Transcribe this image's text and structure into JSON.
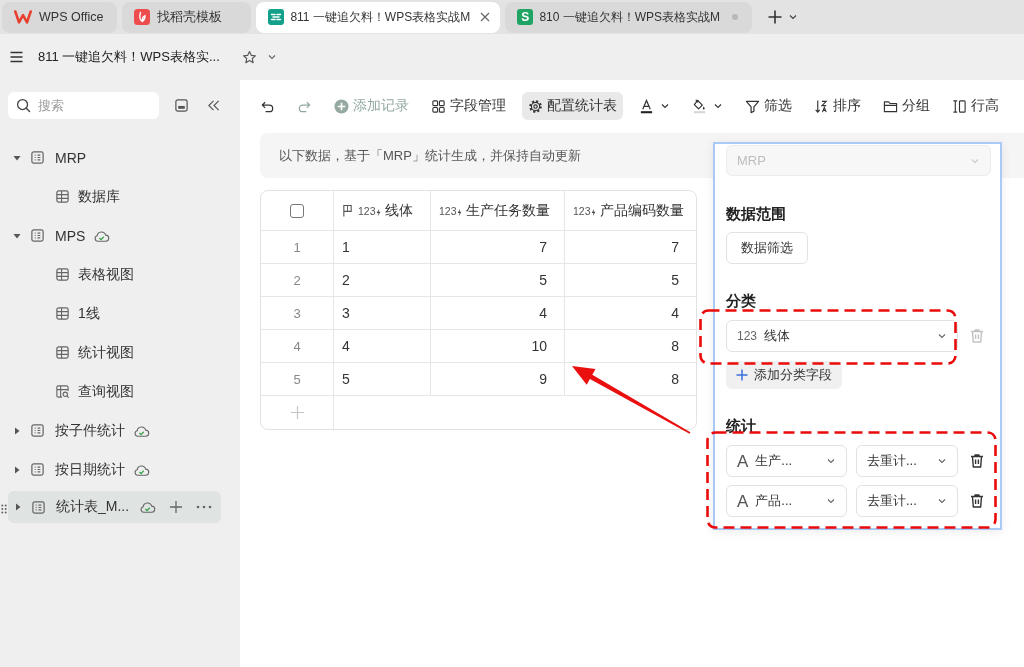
{
  "tabs": [
    {
      "kind": "home",
      "label": "WPS Office",
      "selected": false,
      "modified": false
    },
    {
      "kind": "docer",
      "label": "找稻壳模板",
      "selected": false,
      "modified": false
    },
    {
      "kind": "base",
      "label": "811 一键追欠料！WPS表格实战M",
      "selected": true,
      "modified": false
    },
    {
      "kind": "sheet",
      "icon_text": "S",
      "label": "810 一键追欠料！WPS表格实战M",
      "selected": false,
      "modified": true
    }
  ],
  "title_bar": {
    "document_title": "811 一键追欠料！WPS表格实..."
  },
  "sidebar": {
    "search": {
      "placeholder": "搜索"
    },
    "tree": [
      {
        "label": "MRP",
        "expanded": true,
        "synced": false,
        "selected": false,
        "children": [
          {
            "kind": "grid",
            "label": "数据库",
            "selected": false
          }
        ]
      },
      {
        "label": "MPS",
        "expanded": true,
        "synced": true,
        "selected": false,
        "children": [
          {
            "kind": "grid",
            "label": "表格视图",
            "selected": false
          },
          {
            "kind": "grid",
            "label": "1线",
            "selected": false
          },
          {
            "kind": "grid",
            "label": "统计视图",
            "selected": false
          },
          {
            "kind": "query",
            "label": "查询视图",
            "selected": false
          }
        ]
      },
      {
        "label": "按子件统计",
        "expanded": false,
        "synced": true,
        "selected": false
      },
      {
        "label": "按日期统计",
        "expanded": false,
        "synced": true,
        "selected": false
      },
      {
        "label": "统计表_M...",
        "expanded": false,
        "synced": true,
        "selected": true
      }
    ]
  },
  "toolbar": [
    {
      "kind": "undo",
      "disabled": false,
      "selected": false
    },
    {
      "kind": "redo",
      "disabled": true,
      "selected": false
    },
    {
      "kind": "add",
      "label": "添加记录",
      "disabled": true,
      "selected": false
    },
    {
      "kind": "fields",
      "label": "字段管理",
      "disabled": false,
      "selected": false
    },
    {
      "kind": "config",
      "label": "配置统计表",
      "disabled": false,
      "selected": true
    },
    {
      "kind": "text_color",
      "disabled": false,
      "selected": false
    },
    {
      "kind": "fill_color",
      "disabled": false,
      "selected": false
    },
    {
      "kind": "filter",
      "label": "筛选",
      "disabled": false,
      "selected": false
    },
    {
      "kind": "sort",
      "label": "排序",
      "disabled": false,
      "selected": false
    },
    {
      "kind": "group",
      "label": "分组",
      "disabled": false,
      "selected": false
    },
    {
      "kind": "row_height",
      "label": "行高",
      "disabled": false,
      "selected": false
    }
  ],
  "banner": "以下数据，基于「MRP」统计生成，并保持自动更新",
  "table": {
    "header_checkbox": {
      "checked": false
    },
    "columns": [
      {
        "label": "线体",
        "type": "123",
        "computed": true,
        "primary": true
      },
      {
        "label": "生产任务数量",
        "type": "123",
        "computed": true,
        "primary": false
      },
      {
        "label": "产品编码数量",
        "type": "123",
        "computed": true,
        "primary": false
      }
    ],
    "rows": [
      {
        "index": "1",
        "cells": [
          "1",
          "7",
          "7"
        ]
      },
      {
        "index": "2",
        "cells": [
          "2",
          "5",
          "5"
        ]
      },
      {
        "index": "3",
        "cells": [
          "3",
          "4",
          "4"
        ]
      },
      {
        "index": "4",
        "cells": [
          "4",
          "10",
          "8"
        ]
      },
      {
        "index": "5",
        "cells": [
          "5",
          "9",
          "8"
        ]
      }
    ]
  },
  "config_panel": {
    "source": {
      "value": "MRP",
      "disabled": true
    },
    "range": {
      "title": "数据范围",
      "filter_button": "数据筛选"
    },
    "category": {
      "title": "分类",
      "fields": [
        {
          "type": "123",
          "value": "线体",
          "removable": false
        }
      ],
      "add_button": "添加分类字段"
    },
    "statistics": {
      "title": "统计",
      "rows": [
        {
          "type": "A",
          "field": "生产...",
          "method": "去重计...",
          "removable": true
        },
        {
          "type": "A",
          "field": "产品...",
          "method": "去重计...",
          "removable": true
        }
      ]
    }
  }
}
